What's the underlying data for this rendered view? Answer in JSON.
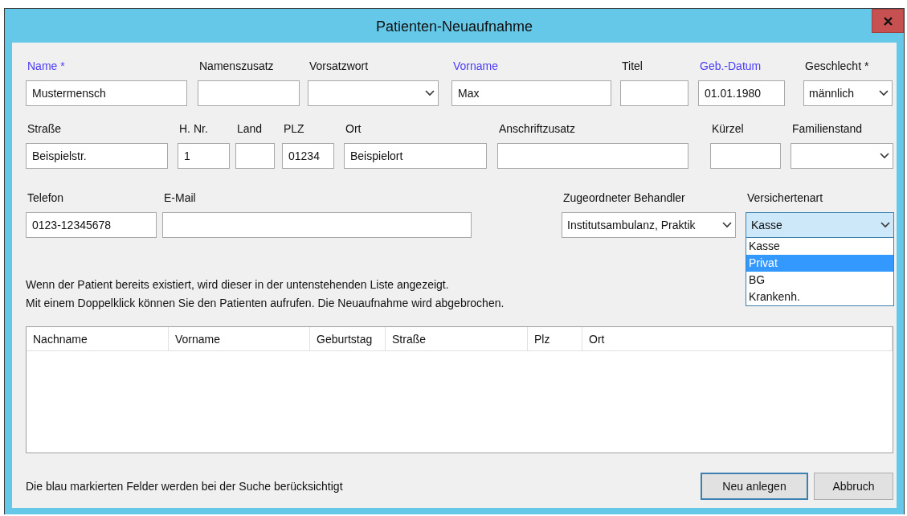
{
  "window": {
    "title": "Patienten-Neuaufnahme"
  },
  "rows": [
    [
      {
        "label": "Name *",
        "search": true,
        "kind": "text",
        "value": "Mustermensch"
      },
      {
        "label": "Namenszusatz",
        "search": false,
        "kind": "text"
      },
      {
        "label": "Vorsatzwort",
        "search": false,
        "kind": "select"
      },
      {
        "label": "Vorname",
        "search": true,
        "kind": "text",
        "value": "Max"
      },
      {
        "label": "Titel",
        "search": false,
        "kind": "text"
      },
      {
        "label": "Geb.-Datum",
        "search": true,
        "kind": "text",
        "value": "01.01.1980"
      },
      {
        "label": "Geschlecht *",
        "search": false,
        "kind": "select",
        "value": "männlich"
      }
    ],
    [
      {
        "label": "Straße",
        "search": false,
        "kind": "text",
        "value": "Beispielstr."
      },
      {
        "label": "H. Nr.",
        "search": false,
        "kind": "text",
        "value": "1"
      },
      {
        "label": "Land",
        "search": false,
        "kind": "text"
      },
      {
        "label": "PLZ",
        "search": false,
        "kind": "text",
        "value": "01234"
      },
      {
        "label": "Ort",
        "search": false,
        "kind": "text",
        "value": "Beispielort"
      },
      {
        "label": "Anschriftzusatz",
        "search": false,
        "kind": "text"
      },
      {
        "label": "Kürzel",
        "search": false,
        "kind": "text"
      },
      {
        "label": "Familienstand",
        "search": false,
        "kind": "select"
      }
    ],
    [
      {
        "label": "Telefon",
        "search": false,
        "kind": "text",
        "value": "0123-12345678"
      },
      {
        "label": "E-Mail",
        "search": false,
        "kind": "text"
      },
      {
        "label": "Zugeordneter Behandler",
        "search": false,
        "kind": "select",
        "value": "Institutsambulanz, Praktik"
      },
      {
        "label": "Versichertenart",
        "search": false,
        "kind": "select",
        "value": "Kasse",
        "expanded": true,
        "options": [
          {
            "label": "Kasse",
            "highlighted": false
          },
          {
            "label": "Privat",
            "highlighted": true
          },
          {
            "label": "BG",
            "highlighted": false
          },
          {
            "label": "Krankenh.",
            "highlighted": false
          }
        ]
      }
    ]
  ],
  "info": [
    "Wenn der Patient bereits existiert, wird dieser in der untenstehenden Liste angezeigt.",
    "Mit einem Doppelklick können Sie den Patienten aufrufen. Die Neuaufnahme wird abgebrochen."
  ],
  "table": {
    "columns": [
      "Nachname",
      "Vorname",
      "Geburtstag",
      "Straße",
      "Plz",
      "Ort"
    ]
  },
  "footer_note": "Die blau markierten Felder werden bei der Suche berücksichtigt",
  "buttons": [
    {
      "label": "Neu anlegen",
      "default": true
    },
    {
      "label": "Abbruch",
      "default": false
    }
  ]
}
